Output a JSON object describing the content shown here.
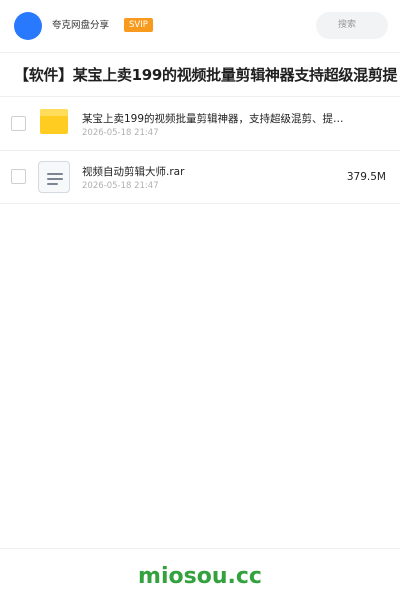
{
  "header": {
    "brand": "夸克网盘分享",
    "badge": "SVIP",
    "search_label": "搜索",
    "colors": {
      "avatar": "#2979ff",
      "badge": "#f79a1e"
    }
  },
  "share": {
    "title": "【软件】某宝上卖199的视频批量剪辑神器支持超级混剪提"
  },
  "files": [
    {
      "icon": "folder-icon",
      "name": "某宝上卖199的视频批量剪辑神器，支持超级混剪、提…",
      "date": "2026-05-18 21:47",
      "size": ""
    },
    {
      "icon": "document-icon",
      "name": "视频自动剪辑大师.rar",
      "date": "2026-05-18 21:47",
      "size": "379.5M"
    }
  ],
  "footer": {
    "logo_text": "miosou.cc",
    "color": "#33a13d"
  }
}
